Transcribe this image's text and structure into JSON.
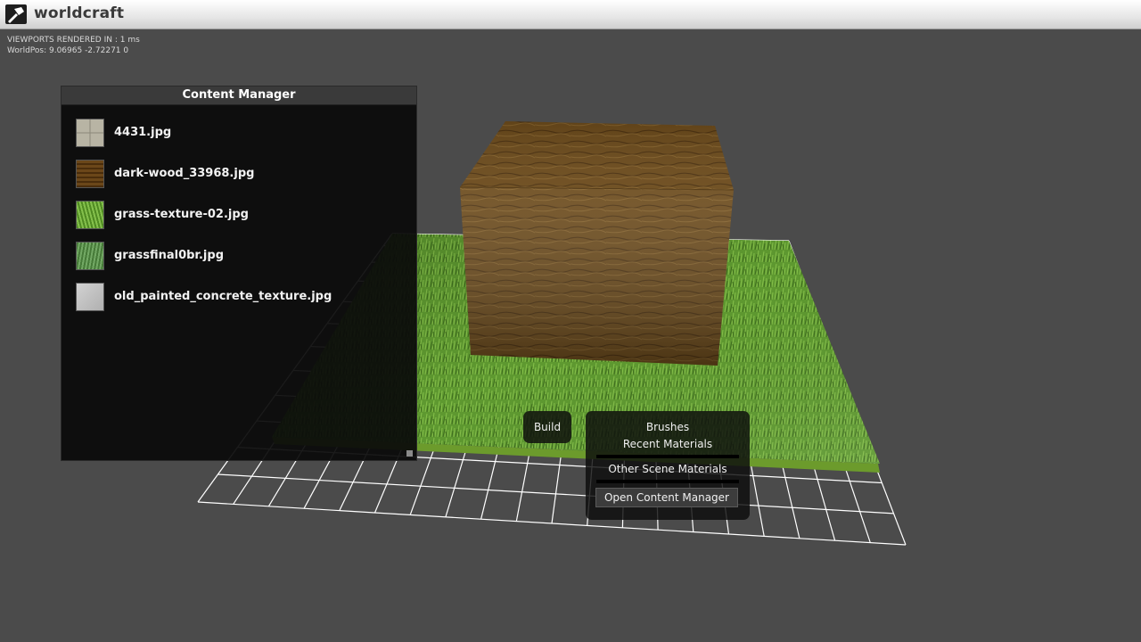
{
  "app": {
    "title": "worldcraft"
  },
  "stats": {
    "render_time": "VIEWPORTS RENDERED IN : 1 ms",
    "world_pos": "WorldPos: 9.06965 -2.72271 0"
  },
  "content_manager": {
    "title": "Content Manager",
    "items": [
      {
        "label": "4431.jpg"
      },
      {
        "label": "dark-wood_33968.jpg"
      },
      {
        "label": "grass-texture-02.jpg"
      },
      {
        "label": "grassfinal0br.jpg"
      },
      {
        "label": "old_painted_concrete_texture.jpg"
      }
    ]
  },
  "toolbar": {
    "build_label": "Build",
    "brushes_label": "Brushes",
    "recent_materials_label": "Recent Materials",
    "other_scene_materials_label": "Other Scene Materials",
    "open_content_manager_label": "Open Content Manager"
  },
  "colors": {
    "background": "#4b4b4b",
    "grid": "#ffffff",
    "grass": "#5f9a2e",
    "wood": "#6b4a1a"
  }
}
